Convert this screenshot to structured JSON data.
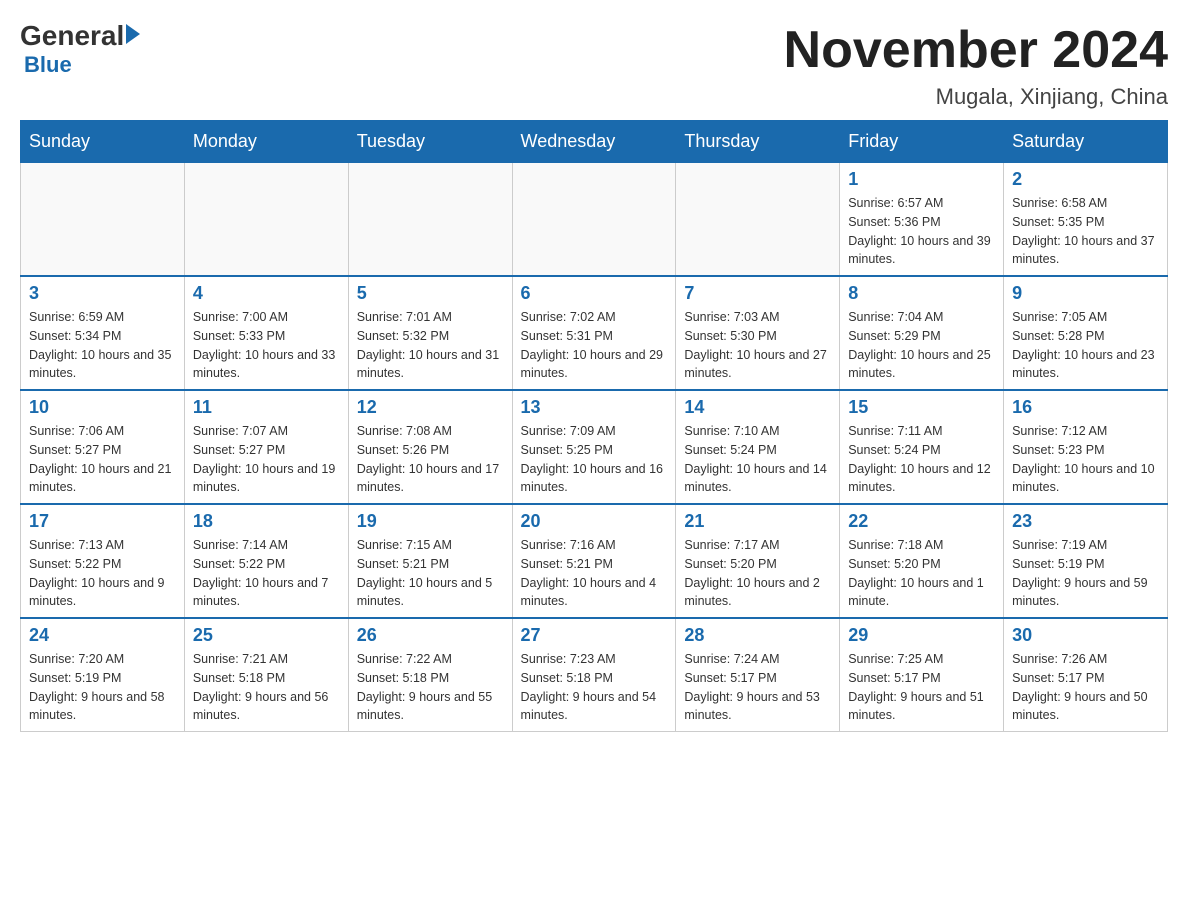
{
  "header": {
    "logo_general": "General",
    "logo_blue": "Blue",
    "calendar_title": "November 2024",
    "calendar_subtitle": "Mugala, Xinjiang, China"
  },
  "weekdays": [
    "Sunday",
    "Monday",
    "Tuesday",
    "Wednesday",
    "Thursday",
    "Friday",
    "Saturday"
  ],
  "weeks": [
    [
      {
        "day": "",
        "info": ""
      },
      {
        "day": "",
        "info": ""
      },
      {
        "day": "",
        "info": ""
      },
      {
        "day": "",
        "info": ""
      },
      {
        "day": "",
        "info": ""
      },
      {
        "day": "1",
        "info": "Sunrise: 6:57 AM\nSunset: 5:36 PM\nDaylight: 10 hours and 39 minutes."
      },
      {
        "day": "2",
        "info": "Sunrise: 6:58 AM\nSunset: 5:35 PM\nDaylight: 10 hours and 37 minutes."
      }
    ],
    [
      {
        "day": "3",
        "info": "Sunrise: 6:59 AM\nSunset: 5:34 PM\nDaylight: 10 hours and 35 minutes."
      },
      {
        "day": "4",
        "info": "Sunrise: 7:00 AM\nSunset: 5:33 PM\nDaylight: 10 hours and 33 minutes."
      },
      {
        "day": "5",
        "info": "Sunrise: 7:01 AM\nSunset: 5:32 PM\nDaylight: 10 hours and 31 minutes."
      },
      {
        "day": "6",
        "info": "Sunrise: 7:02 AM\nSunset: 5:31 PM\nDaylight: 10 hours and 29 minutes."
      },
      {
        "day": "7",
        "info": "Sunrise: 7:03 AM\nSunset: 5:30 PM\nDaylight: 10 hours and 27 minutes."
      },
      {
        "day": "8",
        "info": "Sunrise: 7:04 AM\nSunset: 5:29 PM\nDaylight: 10 hours and 25 minutes."
      },
      {
        "day": "9",
        "info": "Sunrise: 7:05 AM\nSunset: 5:28 PM\nDaylight: 10 hours and 23 minutes."
      }
    ],
    [
      {
        "day": "10",
        "info": "Sunrise: 7:06 AM\nSunset: 5:27 PM\nDaylight: 10 hours and 21 minutes."
      },
      {
        "day": "11",
        "info": "Sunrise: 7:07 AM\nSunset: 5:27 PM\nDaylight: 10 hours and 19 minutes."
      },
      {
        "day": "12",
        "info": "Sunrise: 7:08 AM\nSunset: 5:26 PM\nDaylight: 10 hours and 17 minutes."
      },
      {
        "day": "13",
        "info": "Sunrise: 7:09 AM\nSunset: 5:25 PM\nDaylight: 10 hours and 16 minutes."
      },
      {
        "day": "14",
        "info": "Sunrise: 7:10 AM\nSunset: 5:24 PM\nDaylight: 10 hours and 14 minutes."
      },
      {
        "day": "15",
        "info": "Sunrise: 7:11 AM\nSunset: 5:24 PM\nDaylight: 10 hours and 12 minutes."
      },
      {
        "day": "16",
        "info": "Sunrise: 7:12 AM\nSunset: 5:23 PM\nDaylight: 10 hours and 10 minutes."
      }
    ],
    [
      {
        "day": "17",
        "info": "Sunrise: 7:13 AM\nSunset: 5:22 PM\nDaylight: 10 hours and 9 minutes."
      },
      {
        "day": "18",
        "info": "Sunrise: 7:14 AM\nSunset: 5:22 PM\nDaylight: 10 hours and 7 minutes."
      },
      {
        "day": "19",
        "info": "Sunrise: 7:15 AM\nSunset: 5:21 PM\nDaylight: 10 hours and 5 minutes."
      },
      {
        "day": "20",
        "info": "Sunrise: 7:16 AM\nSunset: 5:21 PM\nDaylight: 10 hours and 4 minutes."
      },
      {
        "day": "21",
        "info": "Sunrise: 7:17 AM\nSunset: 5:20 PM\nDaylight: 10 hours and 2 minutes."
      },
      {
        "day": "22",
        "info": "Sunrise: 7:18 AM\nSunset: 5:20 PM\nDaylight: 10 hours and 1 minute."
      },
      {
        "day": "23",
        "info": "Sunrise: 7:19 AM\nSunset: 5:19 PM\nDaylight: 9 hours and 59 minutes."
      }
    ],
    [
      {
        "day": "24",
        "info": "Sunrise: 7:20 AM\nSunset: 5:19 PM\nDaylight: 9 hours and 58 minutes."
      },
      {
        "day": "25",
        "info": "Sunrise: 7:21 AM\nSunset: 5:18 PM\nDaylight: 9 hours and 56 minutes."
      },
      {
        "day": "26",
        "info": "Sunrise: 7:22 AM\nSunset: 5:18 PM\nDaylight: 9 hours and 55 minutes."
      },
      {
        "day": "27",
        "info": "Sunrise: 7:23 AM\nSunset: 5:18 PM\nDaylight: 9 hours and 54 minutes."
      },
      {
        "day": "28",
        "info": "Sunrise: 7:24 AM\nSunset: 5:17 PM\nDaylight: 9 hours and 53 minutes."
      },
      {
        "day": "29",
        "info": "Sunrise: 7:25 AM\nSunset: 5:17 PM\nDaylight: 9 hours and 51 minutes."
      },
      {
        "day": "30",
        "info": "Sunrise: 7:26 AM\nSunset: 5:17 PM\nDaylight: 9 hours and 50 minutes."
      }
    ]
  ]
}
